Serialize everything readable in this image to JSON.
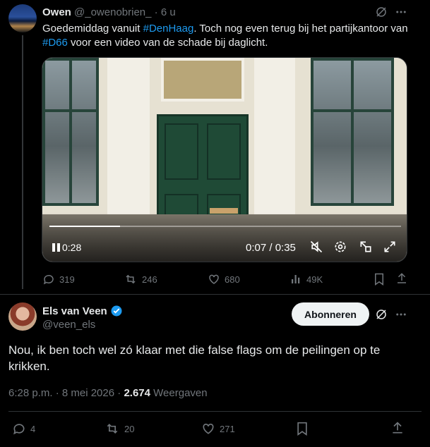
{
  "parent_tweet": {
    "author_name": "Owen",
    "handle": "@_owenobrien_",
    "time_sep": "·",
    "time": "6 u",
    "text_parts": [
      "Goedemiddag vanuit ",
      "#DenHaag",
      ". Toch nog even terug bij het partijkantoor van ",
      "#D66",
      " voor een video van de schade bij daglicht."
    ],
    "video": {
      "elapsed": "0:28",
      "time_display": "0:07 / 0:35",
      "progress": 0.2
    },
    "stats": {
      "replies": "319",
      "reposts": "246",
      "likes": "680",
      "views": "49K"
    }
  },
  "main_tweet": {
    "author_name": "Els van Veen",
    "handle": "@veen_els",
    "follow_label": "Abonneren",
    "text": "Nou, ik ben toch wel zó klaar met die false flags om de peilingen op te krikken.",
    "timestamp": "6:28 p.m. · 8 mei 2026",
    "meta_sep": "·",
    "views_count": "2.674",
    "views_label": "Weergaven",
    "stats": {
      "replies": "4",
      "reposts": "20",
      "likes": "271"
    }
  },
  "colors": {
    "accent": "#1d9bf0",
    "background": "#000000",
    "muted": "#71767b",
    "text": "#e7e9ea"
  }
}
